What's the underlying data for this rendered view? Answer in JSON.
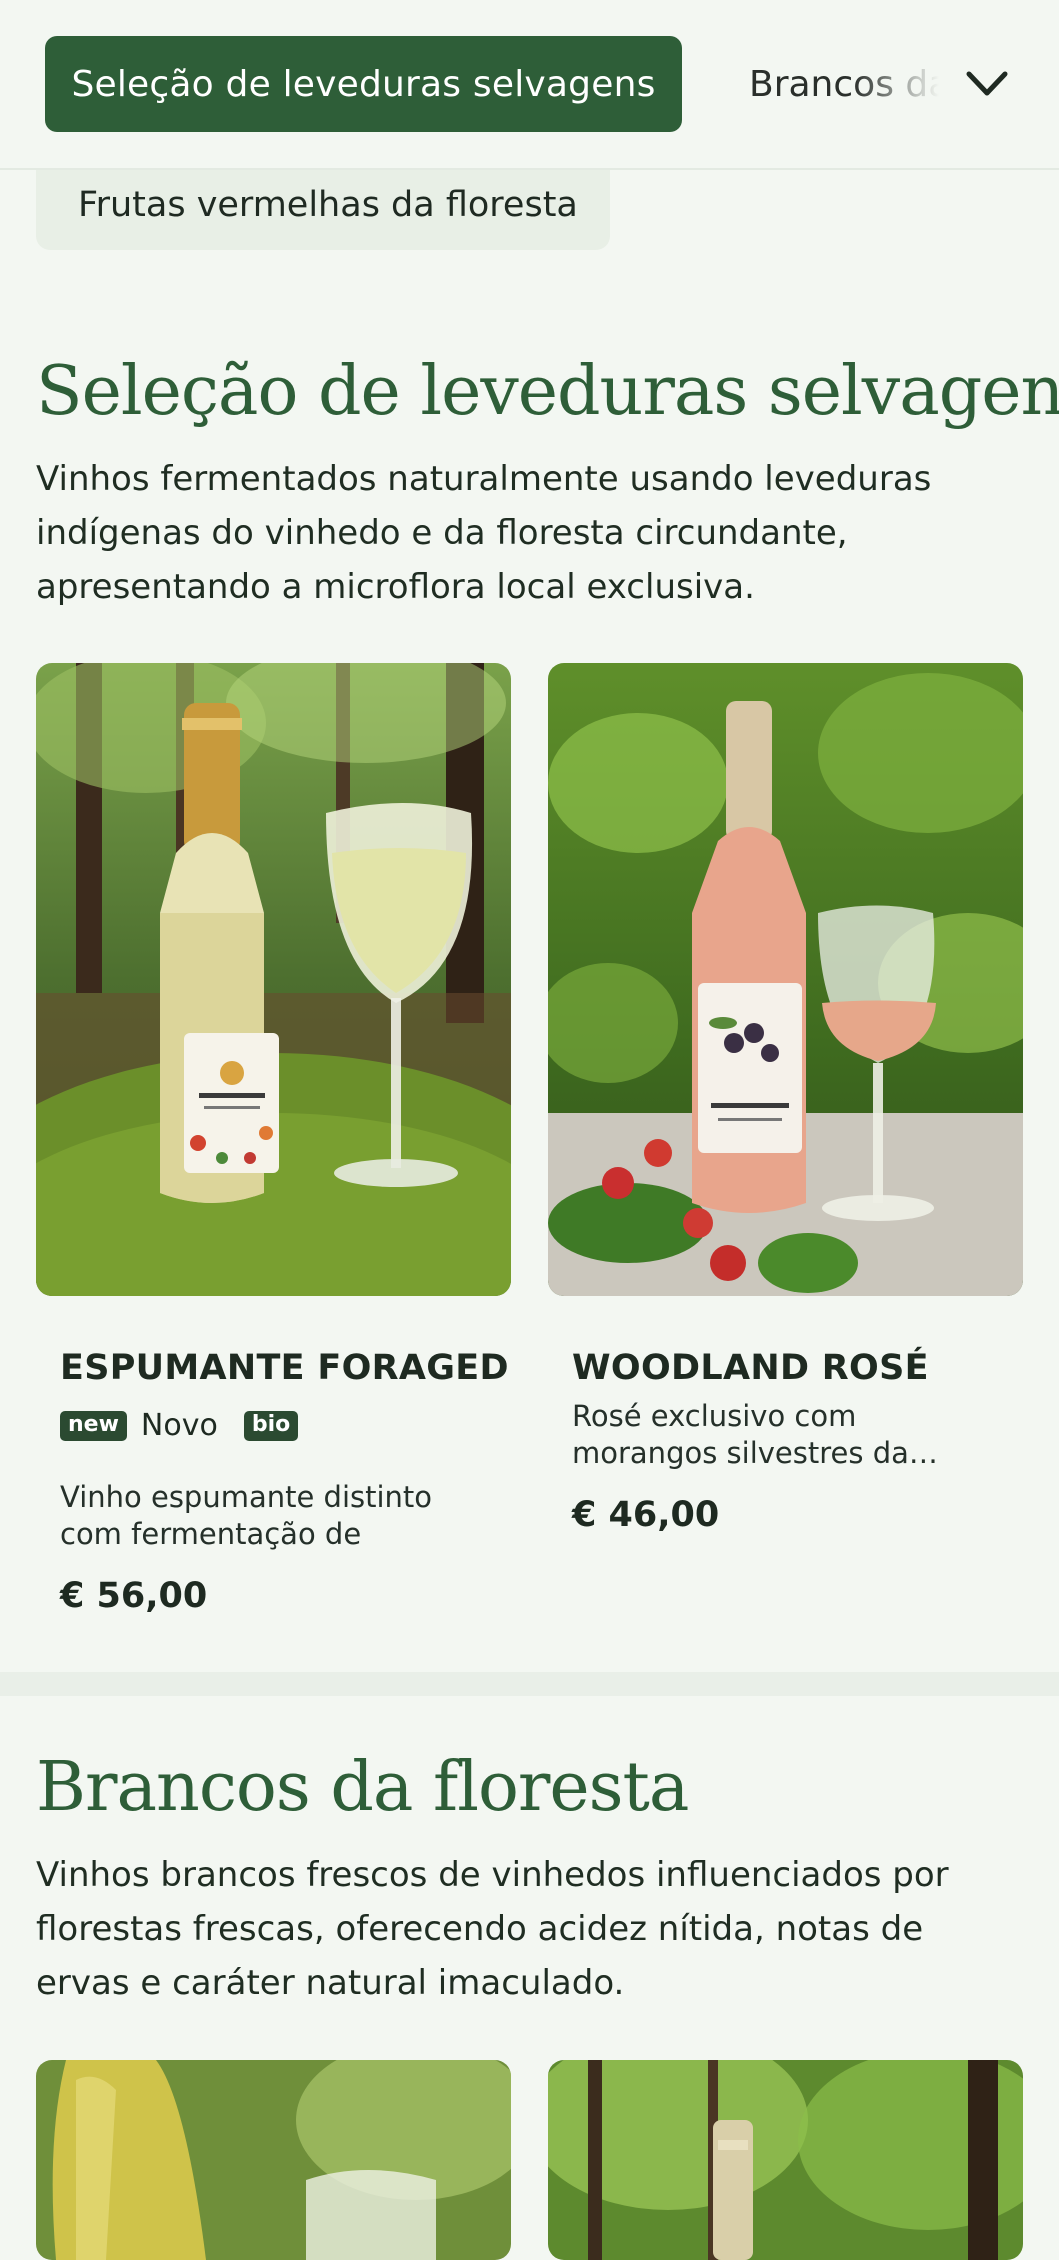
{
  "nav": {
    "active_category": "Seleção de leveduras selvagens",
    "next_category": "Brancos da floresta",
    "sub_category": "Frutas vermelhas da floresta"
  },
  "sections": [
    {
      "title": "Seleção de leveduras selvagens",
      "description": "Vinhos fermentados naturalmente usando leveduras indígenas do vinhedo e da floresta circundante, apresentando a microflora local exclusiva.",
      "products": [
        {
          "name": "ESPUMANTE FORAGED",
          "badge_new": "new",
          "badge_new_label": "Novo",
          "badge_bio": "bio",
          "description": "Vinho espumante distinto com fermentação de levedu…",
          "price": "€ 56,00",
          "image_icon": "sparkling-wine-bottle-image"
        },
        {
          "name": "WOODLAND ROSÉ",
          "description": "Rosé exclusivo com morangos silvestres da…",
          "price": "€ 46,00",
          "image_icon": "rose-wine-bottle-image"
        }
      ]
    },
    {
      "title": "Brancos da floresta",
      "description": "Vinhos brancos frescos de vinhedos influenciados por florestas frescas, oferecendo acidez nítida, notas de ervas e caráter natural imaculado."
    }
  ],
  "colors": {
    "background": "#f3f7f2",
    "accent": "#2e5e38",
    "badge": "#2b4a31"
  }
}
